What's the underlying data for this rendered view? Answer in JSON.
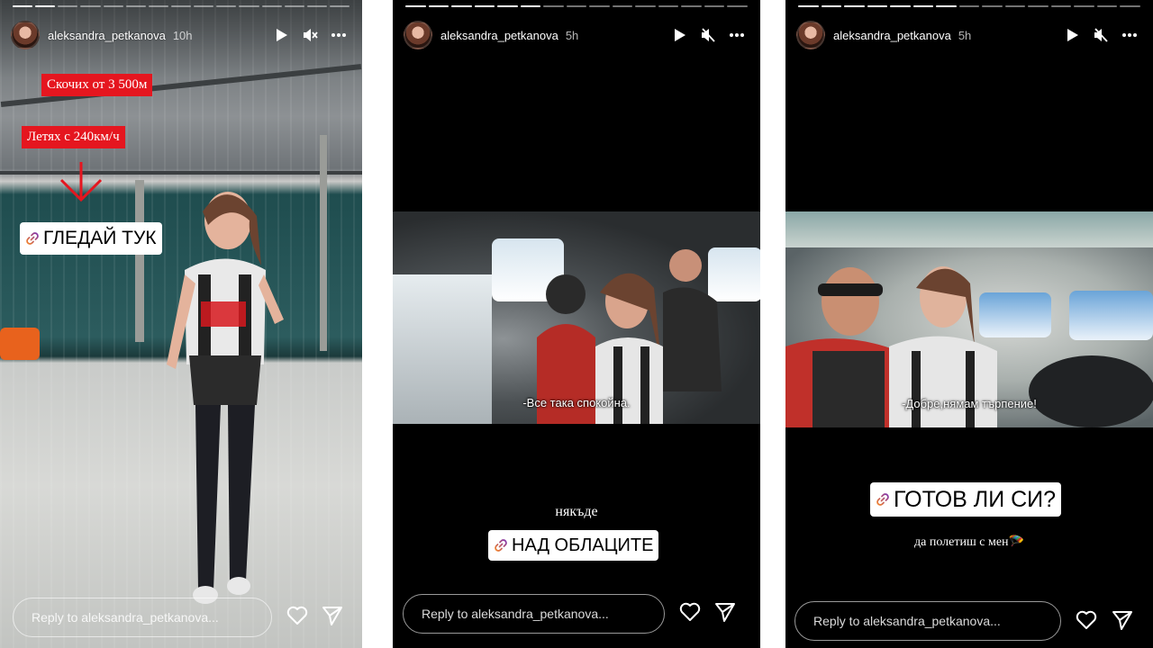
{
  "stories": [
    {
      "username": "aleksandra_petkanova",
      "time": "10h",
      "red_label_1": "Скочих от 3 500м",
      "red_label_2": "Летях с 240км/ч",
      "link_sticker": "ГЛЕДАЙ ТУК",
      "reply_placeholder": "Reply to aleksandra_petkanova..."
    },
    {
      "username": "aleksandra_petkanova",
      "time": "5h",
      "subtitle": "-Все така спокойна.",
      "text_above": "някъде",
      "link_sticker": "НАД ОБЛАЦИТЕ",
      "reply_placeholder": "Reply to aleksandra_petkanova..."
    },
    {
      "username": "aleksandra_petkanova",
      "time": "5h",
      "subtitle": "-Добре,нямам търпение!",
      "link_sticker": "ГОТОВ ЛИ СИ?",
      "text_below": "да полетиш с мен🪂",
      "reply_placeholder": "Reply to aleksandra_petkanova..."
    }
  ],
  "icons": [
    "play-icon",
    "mute-icon",
    "more-icon",
    "link-icon",
    "heart-icon",
    "send-icon",
    "arrow-down-icon"
  ],
  "colors": {
    "red_label": "#e5161f",
    "link_gradient_start": "#f58529",
    "link_gradient_end": "#8134af"
  }
}
